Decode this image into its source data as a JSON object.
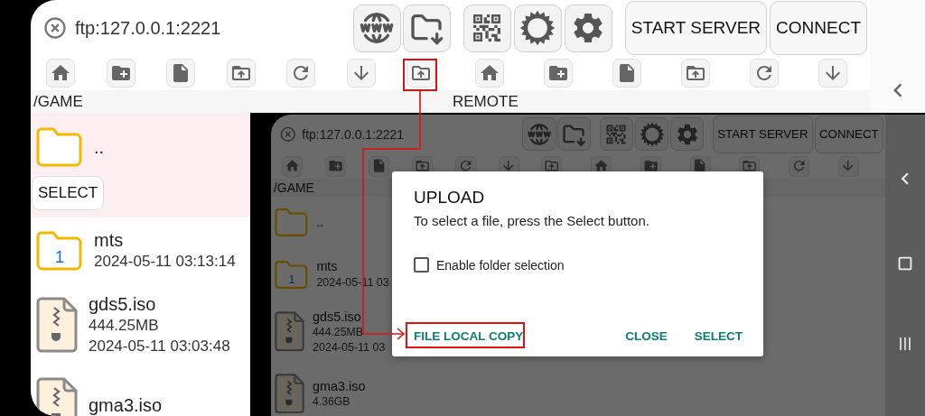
{
  "header": {
    "url": "ftp:127.0.0.1:2221",
    "buttons": [
      "START SERVER",
      "CONNECT"
    ]
  },
  "local_path": "/GAME",
  "remote_label": "REMOTE",
  "local_files": [
    {
      "kind": "parent",
      "name": "..",
      "action": "SELECT",
      "selected": true
    },
    {
      "kind": "folder",
      "name": "mts",
      "count": "1",
      "date": "2024-05-11 03:13:14",
      "selected": false
    },
    {
      "kind": "file",
      "name": "gds5.iso",
      "size": "444.25MB",
      "date": "2024-05-11 03:03:48",
      "selected": false
    },
    {
      "kind": "file",
      "name": "gma3.iso",
      "selected": false
    }
  ],
  "remote_view": {
    "header": {
      "url": "ftp:127.0.0.1:2221",
      "buttons": [
        "START SERVER",
        "CONNECT"
      ]
    },
    "path": "/GAME",
    "files": [
      {
        "kind": "parent",
        "name": ".."
      },
      {
        "kind": "folder",
        "name": "mts",
        "count": "1",
        "date": "2024-05-11 03"
      },
      {
        "kind": "file",
        "name": "gds5.iso",
        "size": "444.25MB",
        "date": "2024-05-11 03"
      },
      {
        "kind": "file",
        "name": "gma3.iso",
        "size": "4.36GB"
      }
    ],
    "dialog": {
      "title": "UPLOAD",
      "message": "To select a file, press the Select button.",
      "checkbox": {
        "label": "Enable folder selection",
        "checked": false
      },
      "actions": [
        "FILE LOCAL COPY",
        "CLOSE",
        "SELECT"
      ]
    }
  }
}
